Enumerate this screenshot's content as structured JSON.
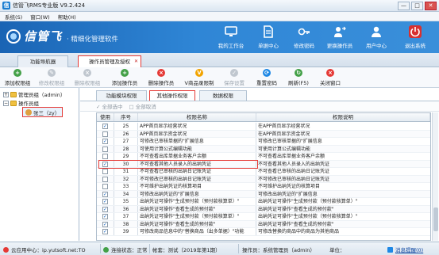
{
  "window": {
    "title": "信管飞RMS专业版 V9.2.424",
    "controls": [
      "—",
      "□",
      "✕"
    ]
  },
  "menu": [
    "系统(S)",
    "窗口(W)",
    "帮助(H)"
  ],
  "brand": {
    "name": "信管飞",
    "slogan": "· 精细化管理软件"
  },
  "nav": [
    {
      "label": "我的工作台",
      "icon": "monitor-icon"
    },
    {
      "label": "单据中心",
      "icon": "document-icon"
    },
    {
      "label": "修改密码",
      "icon": "key-icon"
    },
    {
      "label": "更换操作员",
      "icon": "user-swap-icon"
    },
    {
      "label": "用户中心",
      "icon": "user-icon"
    },
    {
      "label": "退出系统",
      "icon": "power-icon"
    }
  ],
  "tabs": [
    {
      "label": "功能导航器",
      "active": false
    },
    {
      "label": "操作员管理及授权",
      "active": true
    }
  ],
  "tab_close": "✕",
  "toolbar": [
    {
      "label": "添加权限组",
      "glyph": "+",
      "color": "#43a047",
      "disabled": false
    },
    {
      "label": "修改权限组",
      "glyph": "✎",
      "color": "#7f8c99",
      "disabled": true
    },
    {
      "label": "删除权限组",
      "glyph": "×",
      "color": "#7f8c99",
      "disabled": true
    },
    {
      "label": "添加操作员",
      "glyph": "+",
      "color": "#43a047",
      "disabled": false
    },
    {
      "label": "删除操作员",
      "glyph": "×",
      "color": "#e53935",
      "disabled": false
    },
    {
      "label": "V商品录限制",
      "glyph": "V",
      "color": "#f2a400",
      "disabled": false
    },
    {
      "label": "保存设置",
      "glyph": "✓",
      "color": "#7f8c99",
      "disabled": true
    },
    {
      "label": "重置密码",
      "glyph": "⟳",
      "color": "#1e88e5",
      "disabled": false
    },
    {
      "label": "刷新(F5)",
      "glyph": "↻",
      "color": "#43a047",
      "disabled": false
    },
    {
      "label": "关闭窗口",
      "glyph": "×",
      "color": "#e53935",
      "disabled": false
    }
  ],
  "tree": [
    {
      "label": "管理员组（admin）",
      "expander": "+",
      "level": 0
    },
    {
      "label": "操作员组",
      "expander": "−",
      "level": 0
    },
    {
      "label": "张三（zy）",
      "expander": "",
      "level": 1,
      "selected": true
    }
  ],
  "subtabs": [
    {
      "label": "功能模块权限",
      "active": false
    },
    {
      "label": "其他操作权限",
      "active": true
    },
    {
      "label": "数据权限",
      "active": false
    }
  ],
  "select_all": "全部选中",
  "cancel_all": "全部取消",
  "columns": [
    "使用",
    "序号",
    "权限名称",
    "权限说明"
  ],
  "rows": [
    {
      "used": true,
      "no": "25",
      "name": "APP首页显示经营状况",
      "desc": "在APP首页显示经营状况"
    },
    {
      "used": false,
      "no": "26",
      "name": "APP首页显示资金状况",
      "desc": "在APP首页显示资金状况"
    },
    {
      "used": true,
      "no": "27",
      "name": "可修改已审核单据的\"扩展信息",
      "desc": "可修改已审核单据的\"扩展信息"
    },
    {
      "used": false,
      "no": "28",
      "name": "可使用计算公式编辑功能",
      "desc": "可使用计算公式编辑功能"
    },
    {
      "used": false,
      "no": "29",
      "name": "不可查看出库单据业务客户余额",
      "desc": "不可查看出库单据业务客户余额"
    },
    {
      "used": true,
      "no": "30",
      "name": "不可查看其他人员录入的出纳凭证",
      "desc": "不可查看其他人员录入的出纳凭证"
    },
    {
      "used": false,
      "no": "31",
      "name": "不可查看已审核的出纳日记账凭证",
      "desc": "不可查看已审核的出纳日记账凭证"
    },
    {
      "used": false,
      "no": "32",
      "name": "不可修改已审核的出纳日记账凭证",
      "desc": "不可修改已审核的出纳日记账凭证"
    },
    {
      "used": false,
      "no": "33",
      "name": "不可维护出纳凭证的核算项目",
      "desc": "不可维护出纳凭证的核算项目"
    },
    {
      "used": true,
      "no": "34",
      "name": "可修改出纳凭证的\"扩展信息",
      "desc": "可修改出纳凭证的\"扩展信息"
    },
    {
      "used": true,
      "no": "35",
      "name": "出纳凭证可操作\"生成预付款（预付款核算单）\"",
      "desc": "出纳凭证可操作\"生成预付款（预付款核算单）\""
    },
    {
      "used": true,
      "no": "36",
      "name": "出纳凭证可操作\"查看生成的预付款\"",
      "desc": "出纳凭证可操作\"查看生成的预付款\""
    },
    {
      "used": true,
      "no": "37",
      "name": "出纳凭证可操作\"生成预付款（预付款核算单）\"",
      "desc": "出纳凭证可操作\"生成预付款（预付款核算单）\""
    },
    {
      "used": true,
      "no": "38",
      "name": "出纳凭证可操作\"查看生成的预付款\"",
      "desc": "出纳凭证可操作\"查看生成的预付款\""
    },
    {
      "used": true,
      "no": "39",
      "name": "可修改商品信息中的\"替换商品（出多单据）\"功能",
      "desc": "可修改替换的商品中的商品为其他商品"
    }
  ],
  "status": {
    "cloud": "云应用中心：ip.yutsoft.net:TO",
    "conn": "连接状态：正常",
    "account": "帐套：测试（2019年第1期）",
    "operator": "操作员：系统管理员（admin）",
    "unit": "单位：",
    "messages": "消息提醒(0)"
  },
  "colors": {
    "accent": "#2f86d6",
    "highlight": "#e53935",
    "check": "#1565c0"
  }
}
